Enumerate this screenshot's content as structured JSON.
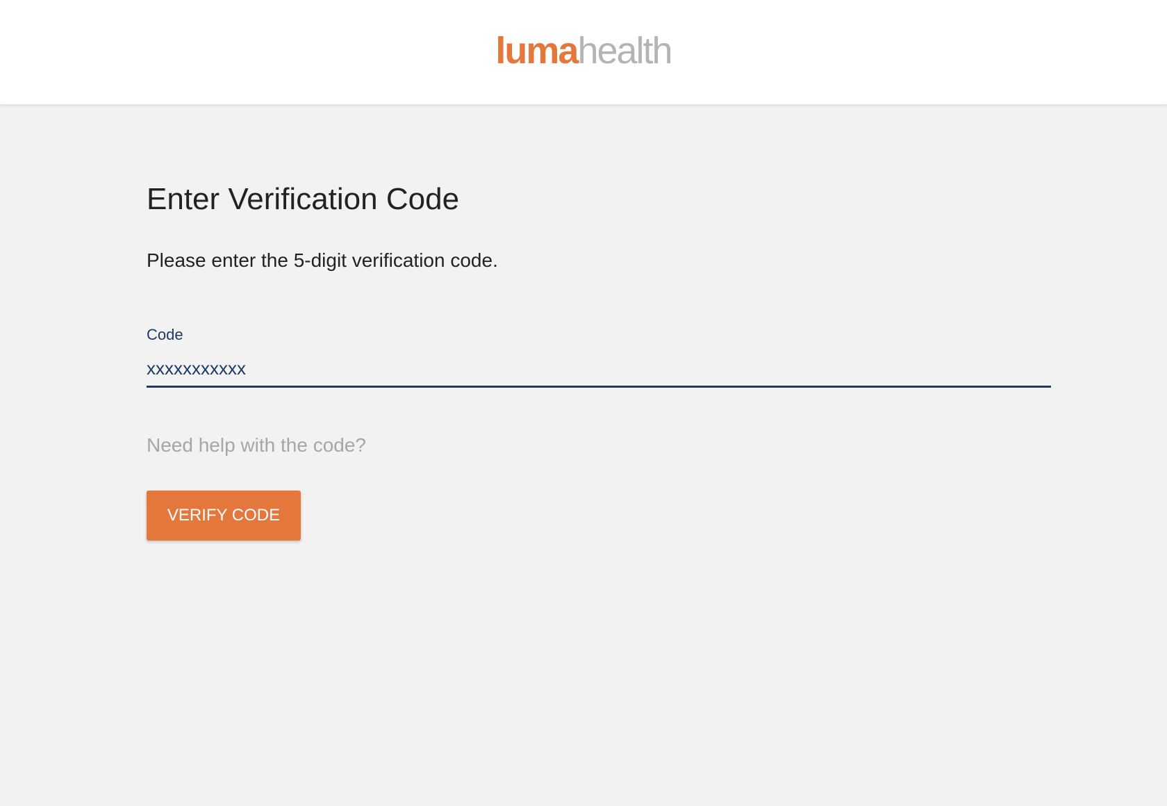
{
  "header": {
    "logo_primary": "luma",
    "logo_secondary": "health"
  },
  "main": {
    "title": "Enter Verification Code",
    "instructions": "Please enter the 5-digit verification code.",
    "code_field": {
      "label": "Code",
      "value": "xxxxxxxxxxx"
    },
    "help_link": "Need help with the code?",
    "verify_button": "VERIFY CODE"
  },
  "colors": {
    "accent": "#e4783c",
    "navy": "#1e3a64",
    "background": "#f2f2f2",
    "logo_secondary": "#b4b4b4",
    "muted_text": "#a6a6a6"
  }
}
